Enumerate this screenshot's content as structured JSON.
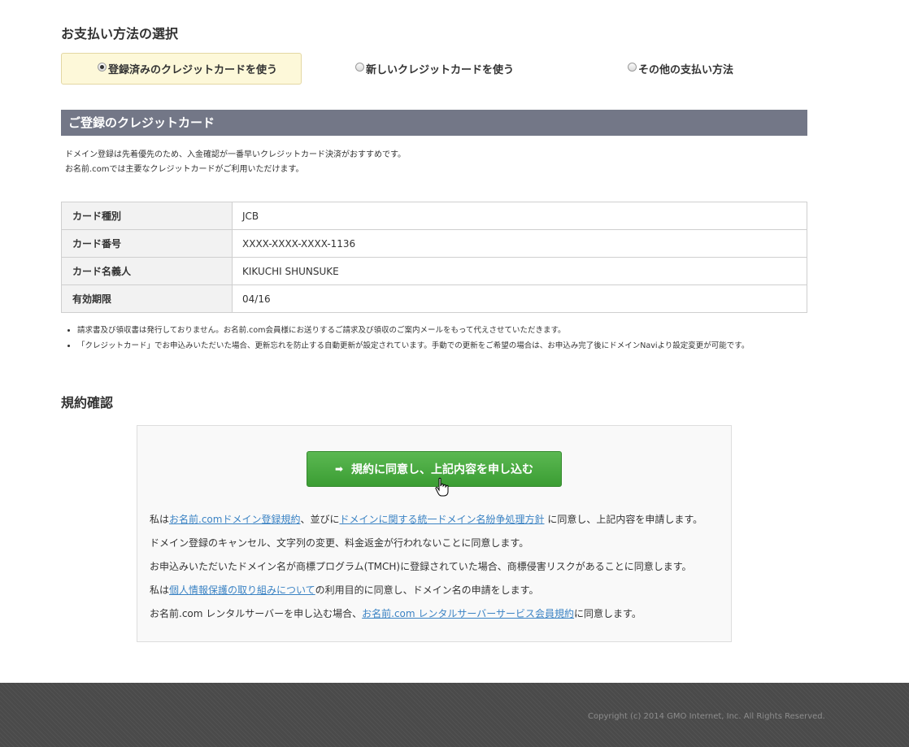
{
  "payment": {
    "title": "お支払い方法の選択",
    "options": [
      {
        "label": "登録済みのクレジットカードを使う",
        "selected": true
      },
      {
        "label": "新しいクレジットカードを使う",
        "selected": false
      },
      {
        "label": "その他の支払い方法",
        "selected": false
      }
    ]
  },
  "card": {
    "header": "ご登録のクレジットカード",
    "intro": [
      "ドメイン登録は先着優先のため、入金確認が一番早いクレジットカード決済がおすすめです。",
      "お名前.comでは主要なクレジットカードがご利用いただけます。"
    ],
    "rows": [
      {
        "label": "カード種別",
        "value": "JCB"
      },
      {
        "label": "カード番号",
        "value": "XXXX-XXXX-XXXX-1136"
      },
      {
        "label": "カード名義人",
        "value": "KIKUCHI SHUNSUKE"
      },
      {
        "label": "有効期限",
        "value": "04/16"
      }
    ],
    "notes": [
      "請求書及び領収書は発行しておりません。お名前.com会員様にお送りするご請求及び領収のご案内メールをもって代えさせていただきます。",
      "「クレジットカード」でお申込みいただいた場合、更新忘れを防止する自動更新が設定されています。手動での更新をご希望の場合は、お申込み完了後にドメインNaviより設定変更が可能です。"
    ]
  },
  "terms": {
    "title": "規約確認",
    "button_label": "規約に同意し、上記内容を申し込む",
    "line1": {
      "pre": "私は",
      "link1": "お名前.comドメイン登録規約",
      "mid": "、並びに",
      "link2": "ドメインに関する統一ドメイン名紛争処理方針",
      "post": " に同意し、上記内容を申請します。"
    },
    "line2": "ドメイン登録のキャンセル、文字列の変更、料金返金が行われないことに同意します。",
    "line3": "お申込みいただいたドメイン名が商標プログラム(TMCH)に登録されていた場合、商標侵害リスクがあることに同意します。",
    "line4": {
      "pre": "私は",
      "link": "個人情報保護の取り組みについて",
      "post": "の利用目的に同意し、ドメイン名の申請をします。"
    },
    "line5": {
      "pre": "お名前.com レンタルサーバーを申し込む場合、",
      "link": "お名前.com レンタルサーバーサービス会員規約",
      "post": "に同意します。"
    }
  },
  "footer": {
    "copyright": "Copyright (c) 2014 GMO Internet, Inc. All Rights Reserved."
  },
  "colors": {
    "header_bar": "#737787",
    "selected_option_bg": "#fdf8d9",
    "button_green": "#4aab41",
    "link": "#3b83c4",
    "footer_bg": "#4a4a4a"
  }
}
